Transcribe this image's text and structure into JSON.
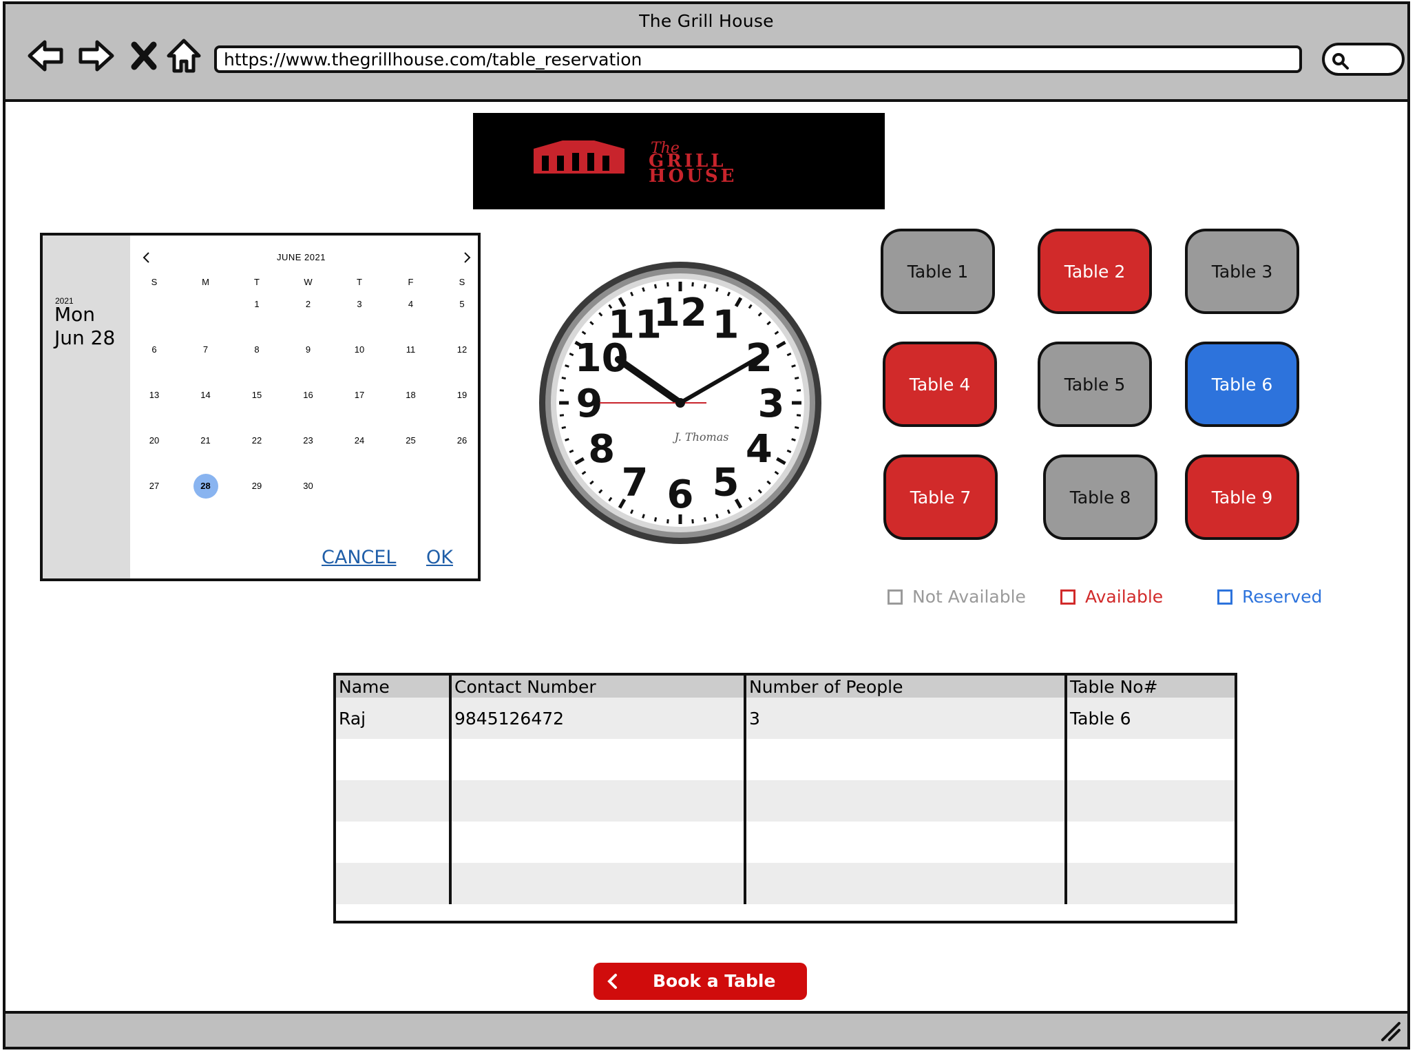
{
  "window": {
    "title": "The Grill House",
    "url": "https://www.thegrillhouse.com/table_reservation"
  },
  "logo": {
    "text_small": "The",
    "text_line1": "GRILL",
    "text_line2": "HOUSE",
    "color": "#c8242c"
  },
  "calendar": {
    "year": "2021",
    "weekday": "Mon",
    "date": "Jun 28",
    "month_label": "JUNE 2021",
    "days_of_week": [
      "S",
      "M",
      "T",
      "W",
      "T",
      "F",
      "S"
    ],
    "days": [
      "1",
      "2",
      "3",
      "4",
      "5",
      "6",
      "7",
      "8",
      "9",
      "10",
      "11",
      "12",
      "13",
      "14",
      "15",
      "16",
      "17",
      "18",
      "19",
      "20",
      "21",
      "22",
      "23",
      "24",
      "25",
      "26",
      "27",
      "28",
      "29",
      "30"
    ],
    "first_weekday_index": 2,
    "selected_day": "28",
    "cancel_label": "CANCEL",
    "ok_label": "OK"
  },
  "clock": {
    "brand": "J. Thomas",
    "numerals": [
      "12",
      "1",
      "2",
      "3",
      "4",
      "5",
      "6",
      "7",
      "8",
      "9",
      "10",
      "11"
    ],
    "time": "10:10"
  },
  "tables": [
    {
      "label": "Table 1",
      "status": "not-available"
    },
    {
      "label": "Table 2",
      "status": "available"
    },
    {
      "label": "Table 3",
      "status": "not-available"
    },
    {
      "label": "Table 4",
      "status": "available"
    },
    {
      "label": "Table 5",
      "status": "not-available"
    },
    {
      "label": "Table 6",
      "status": "reserved"
    },
    {
      "label": "Table 7",
      "status": "available"
    },
    {
      "label": "Table 8",
      "status": "not-available"
    },
    {
      "label": "Table 9",
      "status": "available"
    }
  ],
  "legend": {
    "not_available": "Not Available",
    "available": "Available",
    "reserved": "Reserved",
    "colors": {
      "not_available": "#9a9a9a",
      "available": "#d12a2a",
      "reserved": "#2d73dc"
    }
  },
  "reservations": {
    "columns": [
      "Name",
      "Contact Number",
      "Number of People",
      "Table No#"
    ],
    "rows": [
      [
        "Raj",
        "9845126472",
        "3",
        "Table 6"
      ],
      [
        "",
        "",
        "",
        ""
      ],
      [
        "",
        "",
        "",
        ""
      ],
      [
        "",
        "",
        "",
        ""
      ],
      [
        "",
        "",
        "",
        ""
      ]
    ]
  },
  "book_button": {
    "label": "Book a Table",
    "color": "#d00c0c"
  }
}
